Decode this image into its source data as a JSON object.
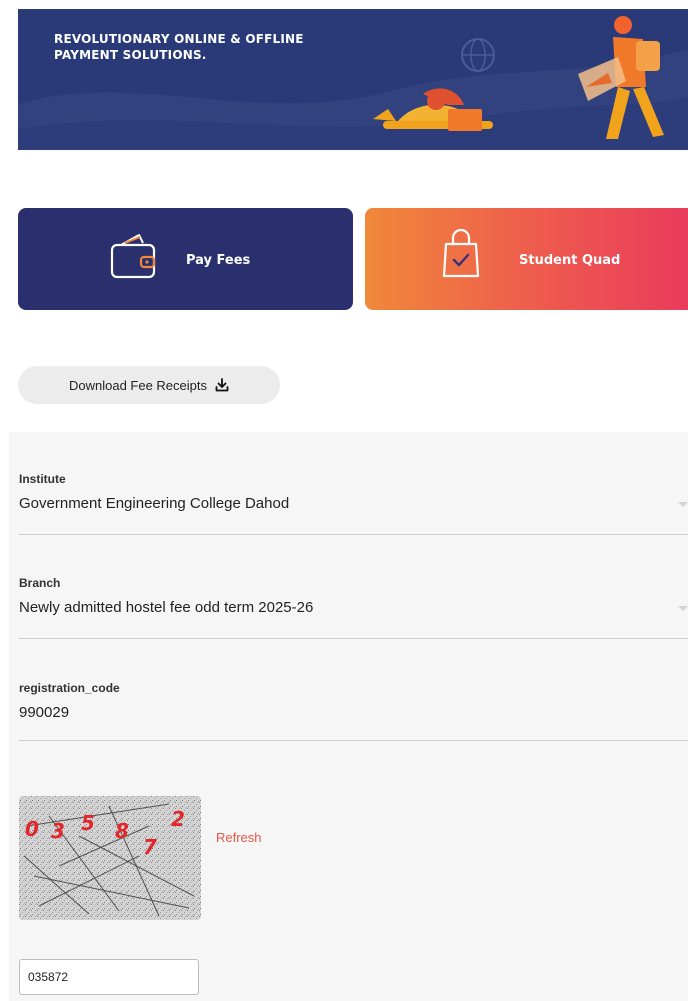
{
  "banner": {
    "title": "REVOLUTIONARY ONLINE & OFFLINE\nPAYMENT SOLUTIONS."
  },
  "tiles": [
    {
      "label": "Pay Fees",
      "icon": "wallet-icon"
    },
    {
      "label": "Student Quad",
      "icon": "shopping-bag-icon"
    }
  ],
  "download": {
    "label": "Download Fee Receipts",
    "icon": "download-icon"
  },
  "form": {
    "institute": {
      "label": "Institute",
      "value": "Government Engineering College Dahod"
    },
    "branch": {
      "label": "Branch",
      "value": "Newly admitted hostel fee odd term 2025-26"
    },
    "registration": {
      "label": "registration_code",
      "value": "990029"
    },
    "captcha": {
      "digits": [
        "0",
        "3",
        "5",
        "8",
        "7",
        "2"
      ],
      "refresh_label": "Refresh",
      "input_value": "035872"
    }
  },
  "colors": {
    "navy": "#2a2f6e",
    "banner": "#2a3a78",
    "orange": "#f0883a",
    "pink": "#e93b5c",
    "refresh": "#e8584a"
  }
}
